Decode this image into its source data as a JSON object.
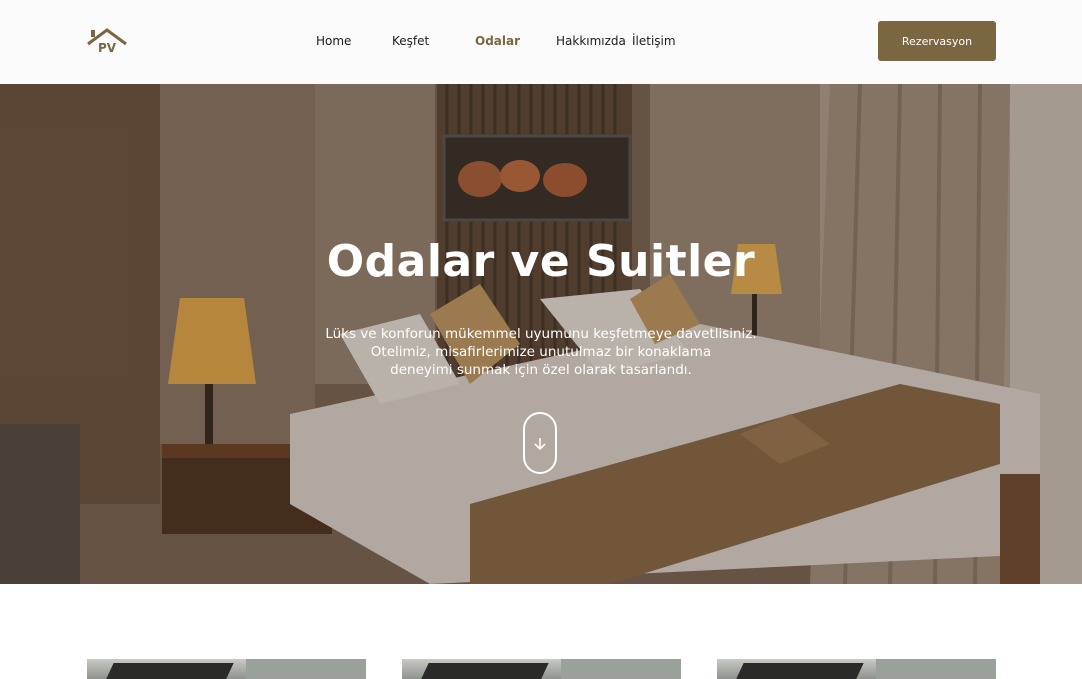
{
  "logo": {
    "text": "PV"
  },
  "nav": {
    "items": [
      {
        "label": "Home"
      },
      {
        "label": "Keşfet"
      },
      {
        "label": "Odalar"
      },
      {
        "label": "Hakkımızda"
      },
      {
        "label": "İletişim"
      }
    ],
    "active": "Odalar"
  },
  "header": {
    "cta_label": "Rezervasyon"
  },
  "hero": {
    "title": "Odalar ve Suitler",
    "lines": [
      "Lüks ve konforun mükemmel uyumunu keşfetmeye davetlisiniz.",
      "Otelimiz, misafirlerimize unutulmaz bir konaklama",
      "deneyimi sunmak için özel olarak tasarlandı."
    ]
  },
  "colors": {
    "accent": "#7a6742",
    "header_bg": "#fbfbfb"
  },
  "icons": {
    "scroll": "arrow-down-icon",
    "logo": "house-roof-icon"
  }
}
